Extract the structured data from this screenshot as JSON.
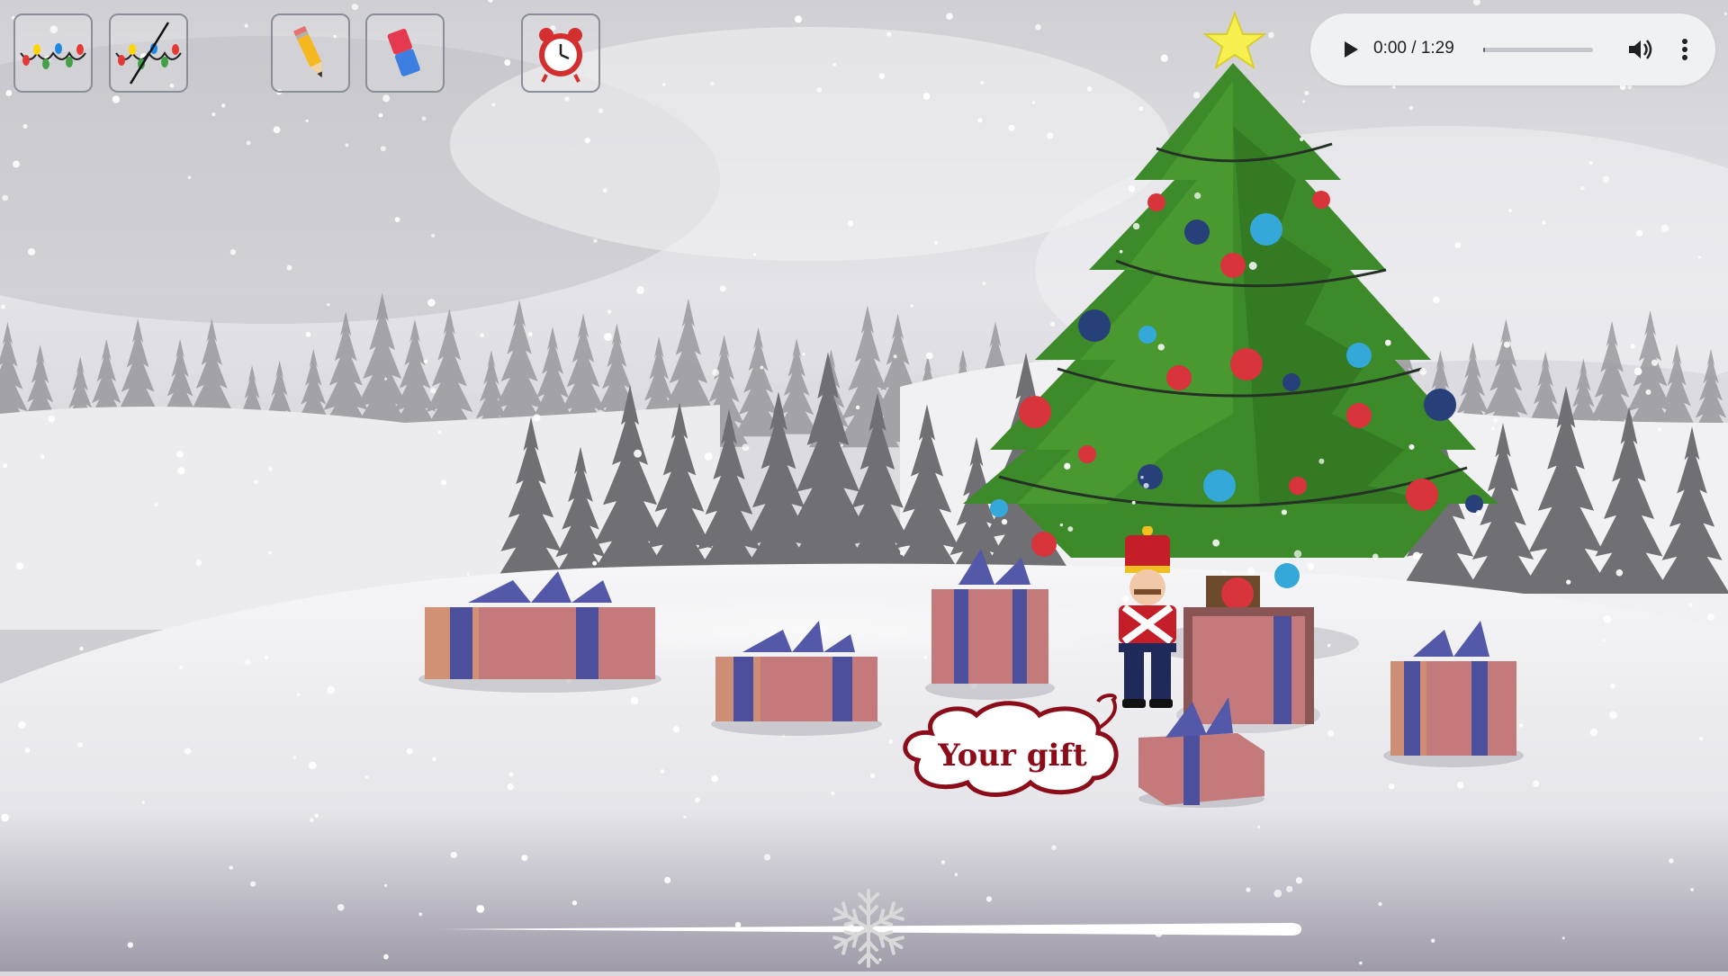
{
  "toolbar": {
    "buttons": [
      {
        "name": "lights-on-button",
        "icon": "string-lights-icon"
      },
      {
        "name": "lights-off-button",
        "icon": "string-lights-crossed-icon"
      },
      {
        "name": "pencil-button",
        "icon": "pencil-icon"
      },
      {
        "name": "eraser-button",
        "icon": "eraser-icon"
      },
      {
        "name": "alarm-clock-button",
        "icon": "alarm-clock-icon"
      }
    ]
  },
  "audio": {
    "current_time": "0:00",
    "duration": "1:29",
    "time_label": "0:00 / 1:29",
    "progress": 0.02,
    "play_icon": "play-icon",
    "volume_icon": "volume-icon",
    "more_icon": "more-vertical-icon"
  },
  "scene": {
    "speech_bubble": "Your gift",
    "tree_topper_icon": "star-icon",
    "character": "toy-soldier"
  },
  "slider": {
    "position": 0.5,
    "thumb_icon": "snowflake-icon"
  },
  "colors": {
    "ribbon": "#4c4f9c",
    "box": "#c47a7a",
    "tree": "#3d8a2a",
    "bubble_text": "#8b0d1a"
  }
}
